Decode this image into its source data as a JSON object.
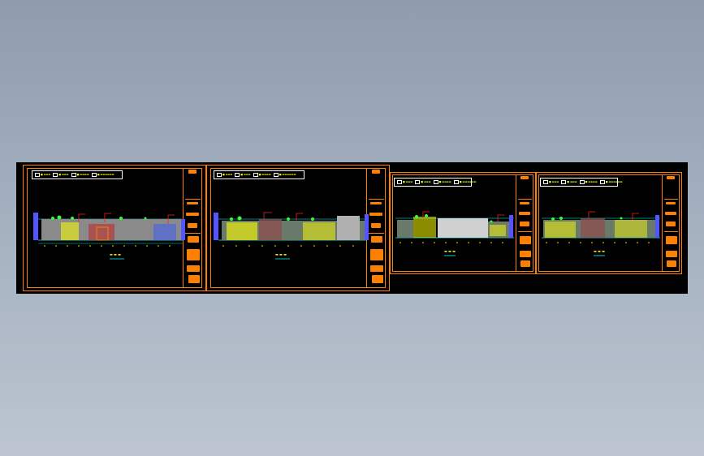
{
  "drawing": {
    "sheets": [
      {
        "id": "sheet-1",
        "legend": [
          "■ ▬▬▬",
          "■ ▬▬▬",
          "■ ▬▬▬▬",
          "■ ▬▬▬▬▬▬"
        ],
        "elevation_label": "▬ ▬ ▬",
        "highlight_color": "#b04040"
      },
      {
        "id": "sheet-2",
        "legend": [
          "■ ▬▬▬",
          "■ ▬▬▬",
          "■ ▬▬▬▬",
          "■ ▬▬▬▬▬▬"
        ],
        "elevation_label": "▬ ▬ ▬",
        "highlight_color": "#ffff00"
      },
      {
        "id": "sheet-3",
        "legend": [
          "■ ▬▬▬",
          "■ ▬▬▬",
          "■ ▬▬▬▬",
          "■ ▬▬▬▬▬▬"
        ],
        "elevation_label": "▬ ▬ ▬",
        "highlight_color": "#ffff00"
      },
      {
        "id": "sheet-4",
        "legend": [
          "■ ▬▬▬",
          "■ ▬▬▬",
          "■ ▬▬▬▬",
          "■ ▬▬▬▬▬▬"
        ],
        "elevation_label": "▬ ▬ ▬",
        "highlight_color": "#ffff00"
      }
    ],
    "colors": {
      "frame": "#ff8000",
      "background": "#000000",
      "text": "#ffff00",
      "grid": "#00ffff",
      "facade": "#8a8a8a",
      "plants": "#33ff33",
      "marker_red": "#ff2020",
      "marker_blue": "#5555ff"
    }
  }
}
